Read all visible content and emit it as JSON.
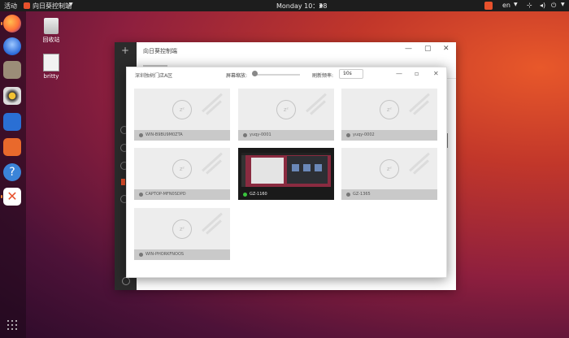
{
  "topbar": {
    "activities": "活动",
    "app_name": "向日葵控制端",
    "clock": "Monday 10：28",
    "lang": "en"
  },
  "desktop": {
    "icons": [
      {
        "label": "回收站",
        "icon": "trash-icon"
      },
      {
        "label": "britty",
        "icon": "file-icon"
      }
    ]
  },
  "dock": {
    "items": [
      "firefox-icon",
      "thunderbird-icon",
      "files-icon",
      "rhythmbox-icon",
      "writer-icon",
      "software-icon",
      "help-icon",
      "sunlogin-icon"
    ]
  },
  "back_window": {
    "title": "向日葵控制端"
  },
  "monitor_window": {
    "title": "深圳独树门店A区",
    "zoom_label": "屏幕缩放:",
    "zoom_level": 0.0,
    "refresh_label": "刷新频率:",
    "refresh_value": "10s",
    "tiles": [
      {
        "label": "WIN-B9BU9M0ZTA",
        "online": false
      },
      {
        "label": "yuqy-0001",
        "online": false
      },
      {
        "label": "yuqy-0002",
        "online": false
      },
      {
        "label": "CAPTOP-MFN0SDPD",
        "online": false
      },
      {
        "label": "GZ-1160",
        "online": true
      },
      {
        "label": "GZ-1365",
        "online": false
      },
      {
        "label": "WIN-PHORKFNOOS",
        "online": false
      }
    ]
  },
  "colors": {
    "accent": "#e7512c",
    "online": "#39c43d",
    "offline": "#777777"
  }
}
